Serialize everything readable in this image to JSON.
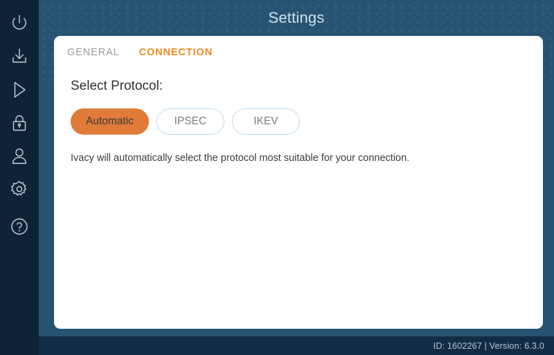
{
  "window": {
    "title": "Settings"
  },
  "sidebar": {
    "items": [
      {
        "icon": "power-icon",
        "name": "sidebar-item-power"
      },
      {
        "icon": "download-icon",
        "name": "sidebar-item-download"
      },
      {
        "icon": "play-icon",
        "name": "sidebar-item-play"
      },
      {
        "icon": "lock-icon",
        "name": "sidebar-item-lock"
      },
      {
        "icon": "user-icon",
        "name": "sidebar-item-account"
      },
      {
        "icon": "gear-icon",
        "name": "sidebar-item-settings"
      },
      {
        "icon": "help-icon",
        "name": "sidebar-item-help"
      }
    ]
  },
  "tabs": [
    {
      "label": "GENERAL",
      "active": false
    },
    {
      "label": "CONNECTION",
      "active": true
    }
  ],
  "main": {
    "section_title": "Select Protocol:",
    "protocols": [
      {
        "label": "Automatic",
        "selected": true
      },
      {
        "label": "IPSEC",
        "selected": false
      },
      {
        "label": "IKEV",
        "selected": false
      }
    ],
    "description": "Ivacy will automatically select the protocol most suitable for your connection."
  },
  "footer": {
    "status": "ID: 1602267 |  Version: 6.3.0",
    "id_label": "ID",
    "id_value": "1602267",
    "version_label": "Version",
    "version_value": "6.3.0"
  },
  "colors": {
    "accent_orange": "#e07b39",
    "tab_active": "#ef8a21",
    "sidebar_bg": "#0f2336",
    "window_bg": "#265371",
    "footer_bg": "#132c45",
    "pill_border": "#b9d9f2"
  }
}
